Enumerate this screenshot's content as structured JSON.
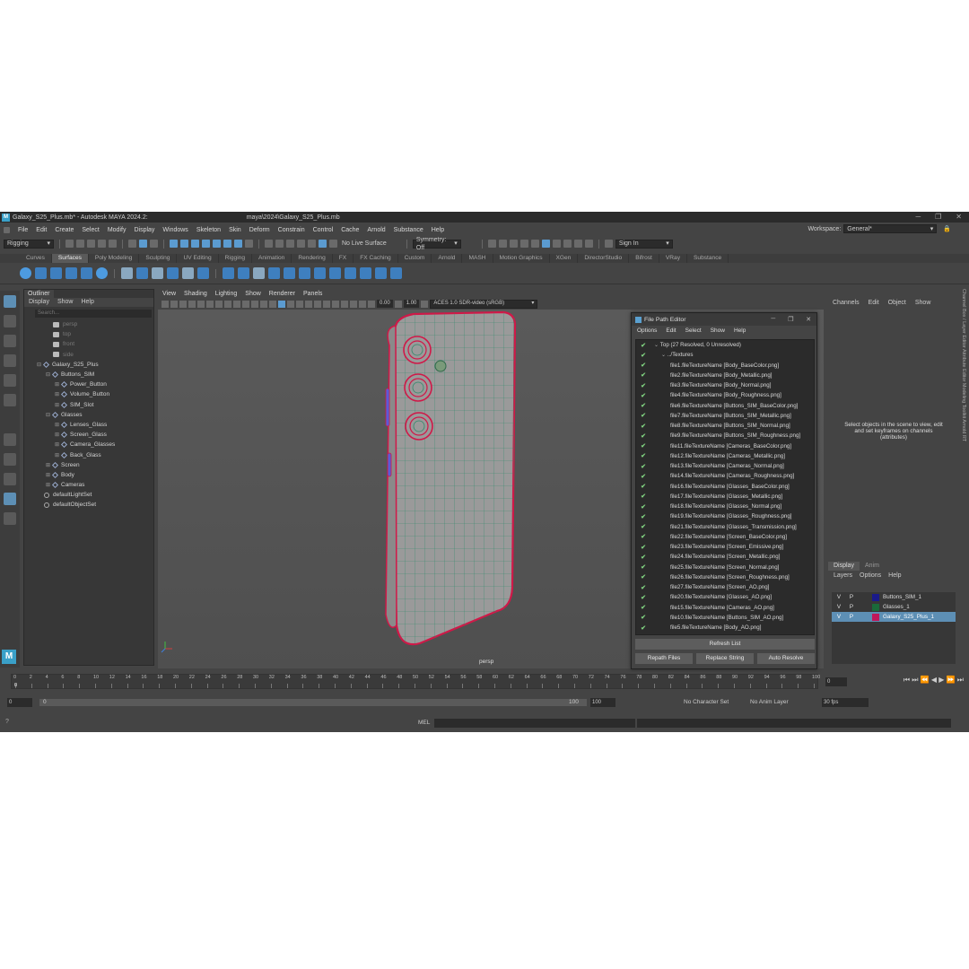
{
  "window": {
    "title": "Galaxy_S25_Plus.mb* - Autodesk MAYA 2024.2:",
    "title_path": "maya\\2024\\Galaxy_S25_Plus.mb",
    "minimize": "─",
    "maximize": "❐",
    "close": "✕"
  },
  "menubar": {
    "items": [
      "File",
      "Edit",
      "Create",
      "Select",
      "Modify",
      "Display",
      "Windows",
      "Skeleton",
      "Skin",
      "Deform",
      "Constrain",
      "Control",
      "Cache",
      "Arnold",
      "Substance",
      "Help"
    ],
    "workspace_label": "Workspace:",
    "workspace_value": "General*"
  },
  "toolbar": {
    "mode": "Rigging",
    "live_surface": "No Live Surface",
    "symmetry": "Symmetry: Off",
    "sign_in": "Sign In"
  },
  "shelf": {
    "tabs": [
      "Curves",
      "Surfaces",
      "Poly Modeling",
      "Sculpting",
      "UV Editing",
      "Rigging",
      "Animation",
      "Rendering",
      "FX",
      "FX Caching",
      "Custom",
      "Arnold",
      "MASH",
      "Motion Graphics",
      "XGen",
      "DirectorStudio",
      "Bifrost",
      "VRay",
      "Substance"
    ],
    "active": "Surfaces"
  },
  "outliner": {
    "tab": "Outliner",
    "menu": [
      "Display",
      "Show",
      "Help"
    ],
    "search_placeholder": "Search...",
    "nodes": [
      {
        "label": "persp",
        "type": "cam",
        "indent": 1,
        "dim": true
      },
      {
        "label": "top",
        "type": "cam",
        "indent": 1,
        "dim": true
      },
      {
        "label": "front",
        "type": "cam",
        "indent": 1,
        "dim": true
      },
      {
        "label": "side",
        "type": "cam",
        "indent": 1,
        "dim": true
      },
      {
        "label": "Galaxy_S25_Plus",
        "type": "grp",
        "indent": 0,
        "exp": "⊟"
      },
      {
        "label": "Buttons_SIM",
        "type": "grp",
        "indent": 1,
        "exp": "⊟"
      },
      {
        "label": "Power_Button",
        "type": "grp",
        "indent": 2,
        "exp": "⊞"
      },
      {
        "label": "Volume_Button",
        "type": "grp",
        "indent": 2,
        "exp": "⊞"
      },
      {
        "label": "SIM_Slot",
        "type": "grp",
        "indent": 2,
        "exp": "⊞"
      },
      {
        "label": "Glasses",
        "type": "grp",
        "indent": 1,
        "exp": "⊟"
      },
      {
        "label": "Lenses_Glass",
        "type": "grp",
        "indent": 2,
        "exp": "⊞"
      },
      {
        "label": "Screen_Glass",
        "type": "grp",
        "indent": 2,
        "exp": "⊞"
      },
      {
        "label": "Camera_Glasses",
        "type": "grp",
        "indent": 2,
        "exp": "⊞"
      },
      {
        "label": "Back_Glass",
        "type": "grp",
        "indent": 2,
        "exp": "⊞"
      },
      {
        "label": "Screen",
        "type": "grp",
        "indent": 1,
        "exp": "⊞"
      },
      {
        "label": "Body",
        "type": "grp",
        "indent": 1,
        "exp": "⊞"
      },
      {
        "label": "Cameras",
        "type": "grp",
        "indent": 1,
        "exp": "⊞"
      },
      {
        "label": "defaultLightSet",
        "type": "set",
        "indent": 0
      },
      {
        "label": "defaultObjectSet",
        "type": "set",
        "indent": 0
      }
    ]
  },
  "viewport": {
    "menu": [
      "View",
      "Shading",
      "Lighting",
      "Show",
      "Renderer",
      "Panels"
    ],
    "exposure": "0.00",
    "gamma": "1.00",
    "color_space": "ACES 1.0 SDR-video (sRGB)",
    "camera_label": "persp"
  },
  "file_path_editor": {
    "title": "File Path Editor",
    "menu": [
      "Options",
      "Edit",
      "Select",
      "Show",
      "Help"
    ],
    "top_label": "Top (27 Resolved, 0 Unresolved)",
    "folder": "../Textures",
    "files": [
      "file1.fileTextureName [Body_BaseColor.png]",
      "file2.fileTextureName [Body_Metallic.png]",
      "file3.fileTextureName [Body_Normal.png]",
      "file4.fileTextureName [Body_Roughness.png]",
      "file6.fileTextureName [Buttons_SIM_BaseColor.png]",
      "file7.fileTextureName [Buttons_SIM_Metallic.png]",
      "file8.fileTextureName [Buttons_SIM_Normal.png]",
      "file9.fileTextureName [Buttons_SIM_Roughness.png]",
      "file11.fileTextureName [Cameras_BaseColor.png]",
      "file12.fileTextureName [Cameras_Metallic.png]",
      "file13.fileTextureName [Cameras_Normal.png]",
      "file14.fileTextureName [Cameras_Roughness.png]",
      "file16.fileTextureName [Glasses_BaseColor.png]",
      "file17.fileTextureName [Glasses_Metallic.png]",
      "file18.fileTextureName [Glasses_Normal.png]",
      "file19.fileTextureName [Glasses_Roughness.png]",
      "file21.fileTextureName [Glasses_Transmission.png]",
      "file22.fileTextureName [Screen_BaseColor.png]",
      "file23.fileTextureName [Screen_Emissive.png]",
      "file24.fileTextureName [Screen_Metallic.png]",
      "file25.fileTextureName [Screen_Normal.png]",
      "file26.fileTextureName [Screen_Roughness.png]",
      "file27.fileTextureName [Screen_AO.png]",
      "file20.fileTextureName [Glasses_AO.png]",
      "file15.fileTextureName [Cameras_AO.png]",
      "file10.fileTextureName [Buttons_SIM_AO.png]",
      "file5.fileTextureName [Body_AO.png]"
    ],
    "refresh": "Refresh List",
    "repath": "Repath Files",
    "replace": "Replace String",
    "auto_resolve": "Auto Resolve"
  },
  "channel_box": {
    "menu": [
      "Channels",
      "Edit",
      "Object",
      "Show"
    ],
    "hint": "Select objects in the scene to view, edit and set keyframes on channels (attributes)",
    "side_tabs": "Channel Box / Layer Editor    Attribute Editor    Modeling Toolkit    Arnold RT"
  },
  "layers": {
    "tabs": [
      "Display",
      "Anim"
    ],
    "menu": [
      "Layers",
      "Options",
      "Help"
    ],
    "rows": [
      {
        "v": "V",
        "p": "P",
        "name": "Buttons_SIM_1",
        "color": "#1a1a8a",
        "selected": false
      },
      {
        "v": "V",
        "p": "P",
        "name": "Glasses_1",
        "color": "#1a6a3a",
        "selected": false
      },
      {
        "v": "V",
        "p": "P",
        "name": "Galaxy_S25_Plus_1",
        "color": "#c0185a",
        "selected": true
      }
    ]
  },
  "timeline": {
    "ticks": [
      "0",
      "2",
      "4",
      "6",
      "8",
      "10",
      "12",
      "14",
      "16",
      "18",
      "20",
      "22",
      "24",
      "26",
      "28",
      "30",
      "32",
      "34",
      "36",
      "38",
      "40",
      "42",
      "44",
      "46",
      "48",
      "50",
      "52",
      "54",
      "56",
      "58",
      "60",
      "62",
      "64",
      "66",
      "68",
      "70",
      "72",
      "74",
      "76",
      "78",
      "80",
      "82",
      "84",
      "86",
      "88",
      "90",
      "92",
      "94",
      "96",
      "98",
      "100"
    ],
    "current_frame": "0",
    "frame_field": "0",
    "playback_icons": "⏮ ⏭ ⏪ ◀ ▶ ⏩ ⏭"
  },
  "range": {
    "start": "0",
    "inner_start": "0",
    "inner_end": "100",
    "end": "100",
    "char_set": "No Character Set",
    "anim_layer": "No Anim Layer",
    "fps": "30 fps"
  },
  "cmd": {
    "mel": "MEL"
  },
  "colors": {
    "accent": "#5d8fb5",
    "resolved": "#7fd07f",
    "phone_edge": "#d01848",
    "mesh": "#2f8a6a"
  }
}
